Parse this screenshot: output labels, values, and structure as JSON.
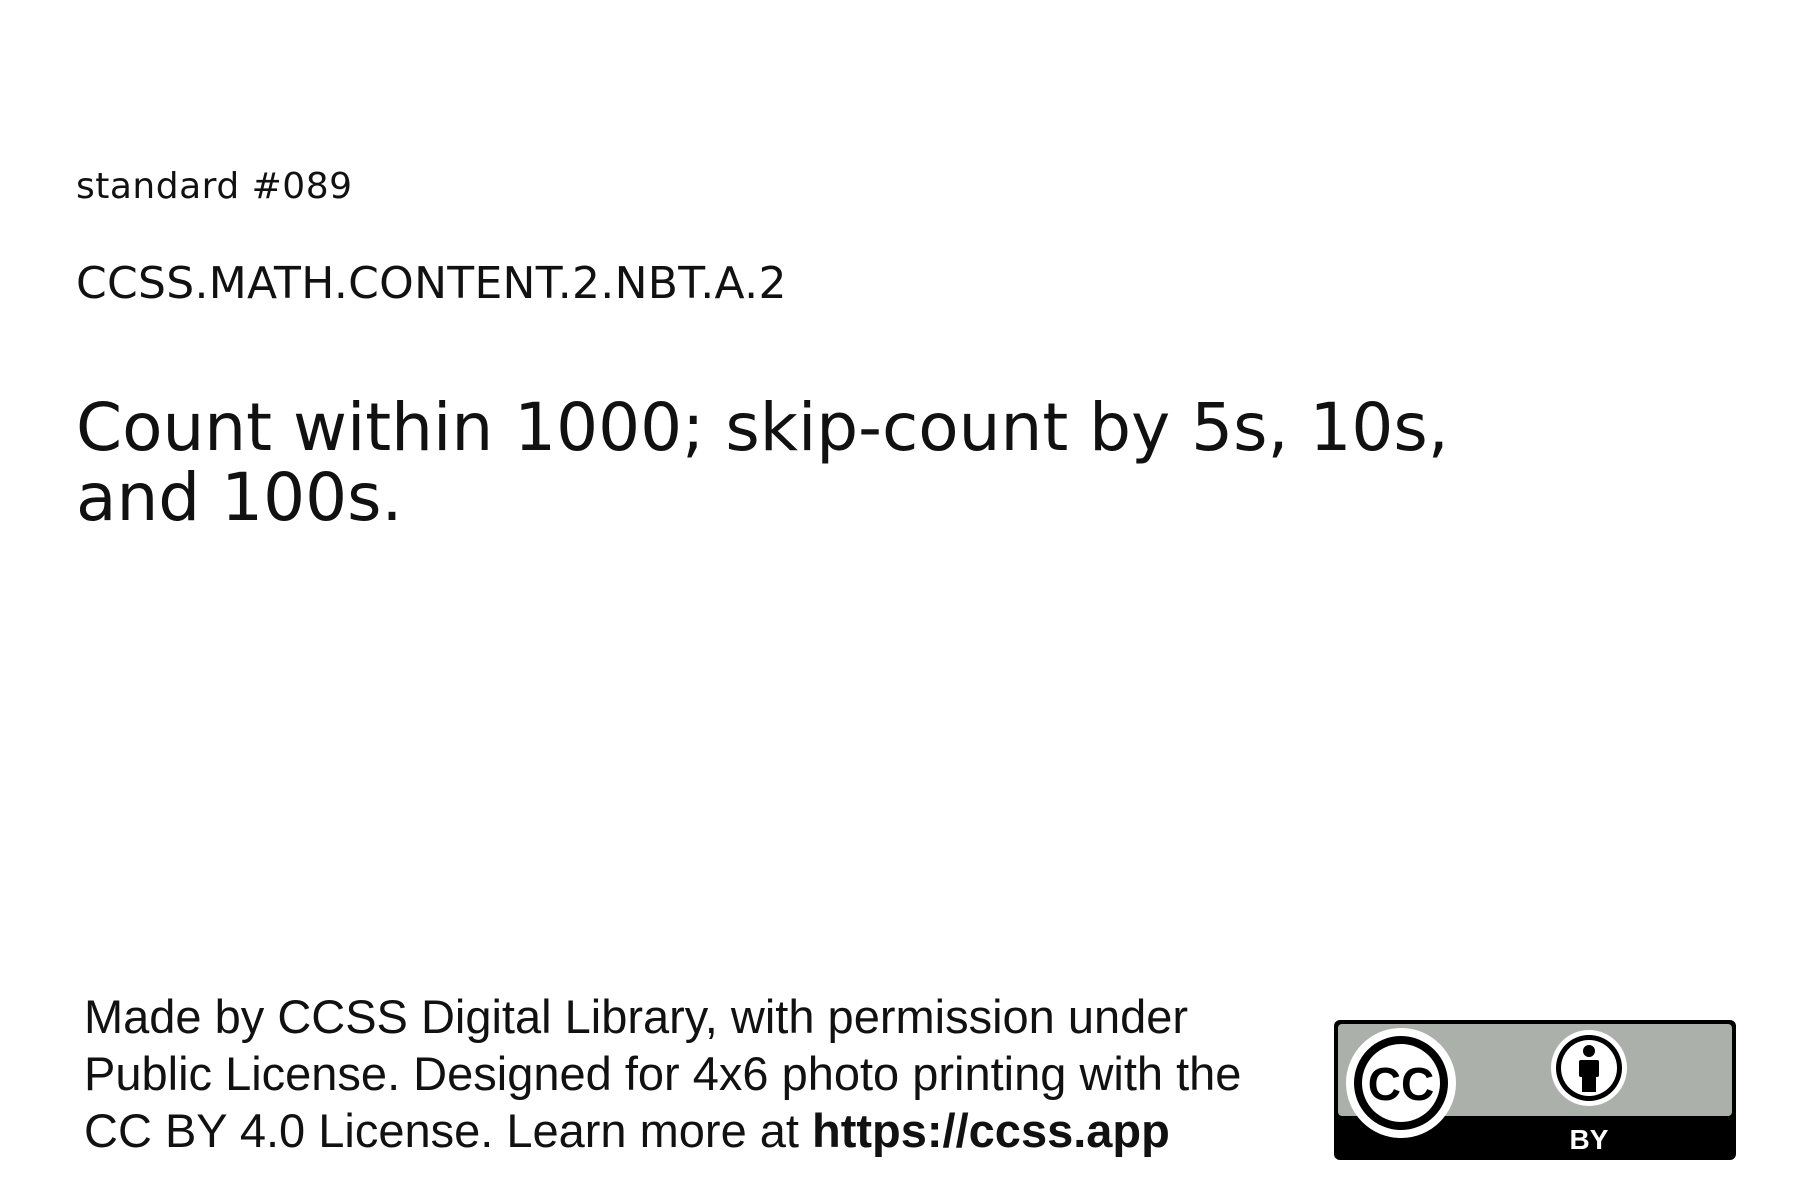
{
  "standard": {
    "number": "standard #089",
    "code": "CCSS.MATH.CONTENT.2.NBT.A.2",
    "description": "Count within 1000; skip-count by 5s, 10s, and 100s."
  },
  "footer": {
    "text_line1": "Made by CCSS Digital Library, with permission under",
    "text_line2": "Public License. Designed for 4x6 photo printing with the",
    "text_line3_prefix": "CC BY 4.0 License. Learn more at ",
    "link": "https://ccss.app"
  },
  "license_badge": {
    "cc_text": "CC",
    "by_text": "BY",
    "colors": {
      "badge_gray": "#abb1aa",
      "black": "#000000",
      "white": "#ffffff"
    },
    "icons": [
      "cc-logo-icon",
      "attribution-person-icon"
    ]
  }
}
